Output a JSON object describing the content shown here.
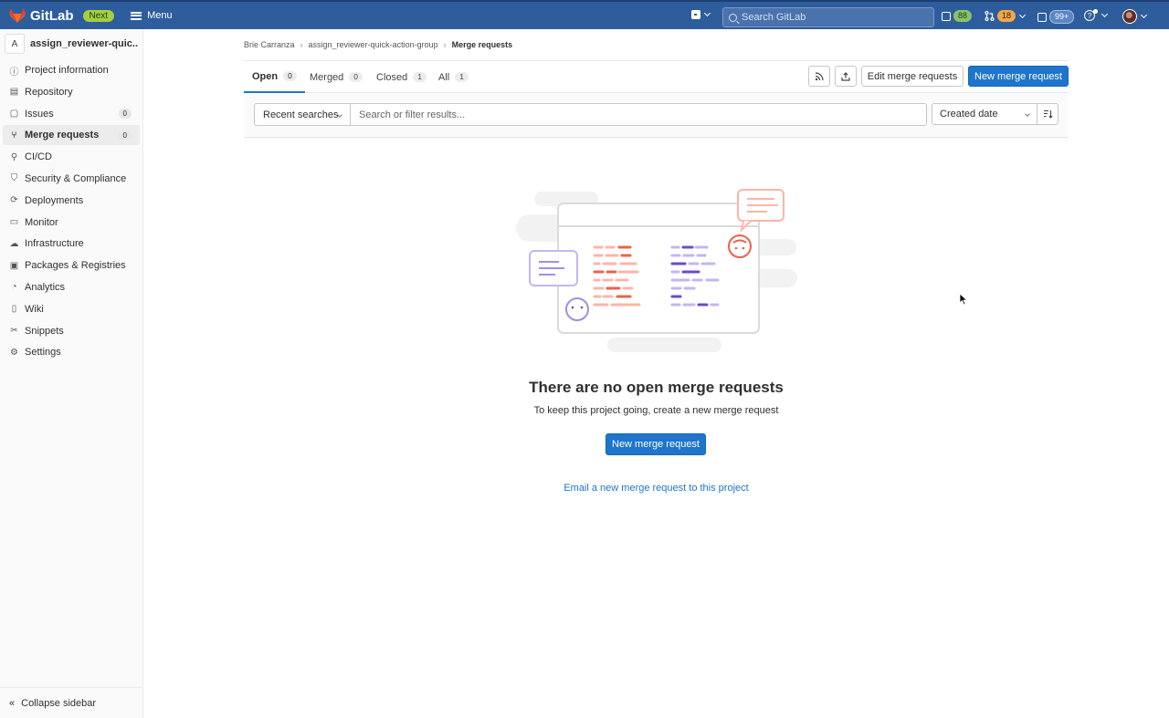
{
  "topbar": {
    "brand": "GitLab",
    "badge": "Next",
    "menu_label": "Menu",
    "search_placeholder": "Search GitLab",
    "issues_count": "88",
    "mr_count": "18",
    "todos_count": "99+",
    "icons": [
      "gitlab-logo",
      "plus-square-icon",
      "issues-icon",
      "merge-request-icon",
      "todo-icon",
      "help-icon",
      "avatar"
    ]
  },
  "sidebar": {
    "project_initial": "A",
    "project_name": "assign_reviewer-quic...",
    "items": [
      {
        "label": "Project information",
        "icon": "information-icon"
      },
      {
        "label": "Repository",
        "icon": "document-icon"
      },
      {
        "label": "Issues",
        "icon": "issues-icon",
        "count": "0"
      },
      {
        "label": "Merge requests",
        "icon": "merge-request-icon",
        "count": "0",
        "active": true
      },
      {
        "label": "CI/CD",
        "icon": "rocket-icon"
      },
      {
        "label": "Security & Compliance",
        "icon": "shield-icon"
      },
      {
        "label": "Deployments",
        "icon": "deployments-icon"
      },
      {
        "label": "Monitor",
        "icon": "monitor-icon"
      },
      {
        "label": "Infrastructure",
        "icon": "cloud-gear-icon"
      },
      {
        "label": "Packages & Registries",
        "icon": "package-icon"
      },
      {
        "label": "Analytics",
        "icon": "chart-icon"
      },
      {
        "label": "Wiki",
        "icon": "book-icon"
      },
      {
        "label": "Snippets",
        "icon": "scissors-icon"
      },
      {
        "label": "Settings",
        "icon": "gear-icon"
      }
    ],
    "collapse_label": "Collapse sidebar"
  },
  "breadcrumb": {
    "items": [
      "Brie Carranza",
      "assign_reviewer-quick-action-group",
      "Merge requests"
    ]
  },
  "tabs": [
    {
      "label": "Open",
      "count": "0"
    },
    {
      "label": "Merged",
      "count": "0"
    },
    {
      "label": "Closed",
      "count": "1"
    },
    {
      "label": "All",
      "count": "1"
    }
  ],
  "actions": {
    "edit_label": "Edit merge requests",
    "new_label": "New merge request"
  },
  "filter": {
    "recent_label": "Recent searches",
    "search_placeholder": "Search or filter results...",
    "sort_label": "Created date"
  },
  "empty_state": {
    "title": "There are no open merge requests",
    "description": "To keep this project going, create a new merge request",
    "button_label": "New merge request",
    "email_link": "Email a new merge request to this project"
  },
  "colors": {
    "navbar": "#2e5d9e",
    "primary": "#1f75cb",
    "accent_orange": "#e9634a",
    "accent_purple": "#6e49cb"
  }
}
